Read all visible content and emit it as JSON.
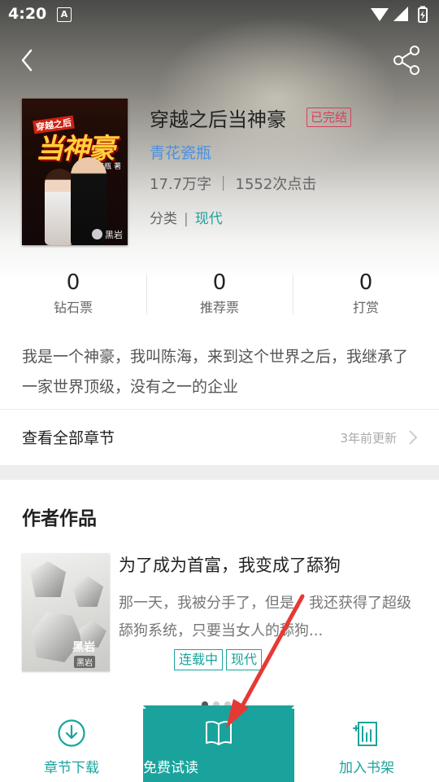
{
  "status_bar": {
    "time": "4:20",
    "indicator": "A"
  },
  "nav": {
    "back_icon": "chevron-left-icon",
    "share_icon": "share-icon"
  },
  "book": {
    "cover_title": "当神豪",
    "cover_subtitle": "穿越之后",
    "cover_author": "青花瓷瓶 著",
    "cover_publisher": "黑岩",
    "title": "穿越之后当神豪",
    "status_badge": "已完结",
    "author": "青花瓷瓶",
    "meta": "17.7万字 ｜ 1552次点击",
    "category_label": "分类",
    "category_sep": "|",
    "category_value": "现代"
  },
  "stats": [
    {
      "value": "0",
      "label": "钻石票"
    },
    {
      "value": "0",
      "label": "推荐票"
    },
    {
      "value": "0",
      "label": "打赏"
    }
  ],
  "intro": "我是一个神豪，我叫陈海，来到这个世界之后，我继承了一家世界顶级，没有之一的企业",
  "chapters": {
    "label": "查看全部章节",
    "update": "3年前更新"
  },
  "author_works": {
    "section_title": "作者作品",
    "items": [
      {
        "title": "为了成为首富，我变成了舔狗",
        "desc": "那一天，我被分手了，但是，我还获得了超级舔狗系统，只要当女人的舔狗...",
        "tags": [
          "连载中",
          "现代"
        ],
        "cover_text": "黑岩",
        "cover_publisher": "黑岩"
      }
    ],
    "pager": {
      "count": 3,
      "active": 0
    }
  },
  "bottom_bar": {
    "download": {
      "label": "章节下载",
      "icon": "download-icon"
    },
    "read": {
      "label": "免费试读",
      "icon": "book-icon"
    },
    "shelf": {
      "label": "加入书架",
      "icon": "bookshelf-add-icon"
    }
  },
  "colors": {
    "accent": "#1aa39c",
    "author_link": "#4a90e2",
    "badge": "#d6405a",
    "annotation_arrow": "#e53935"
  }
}
